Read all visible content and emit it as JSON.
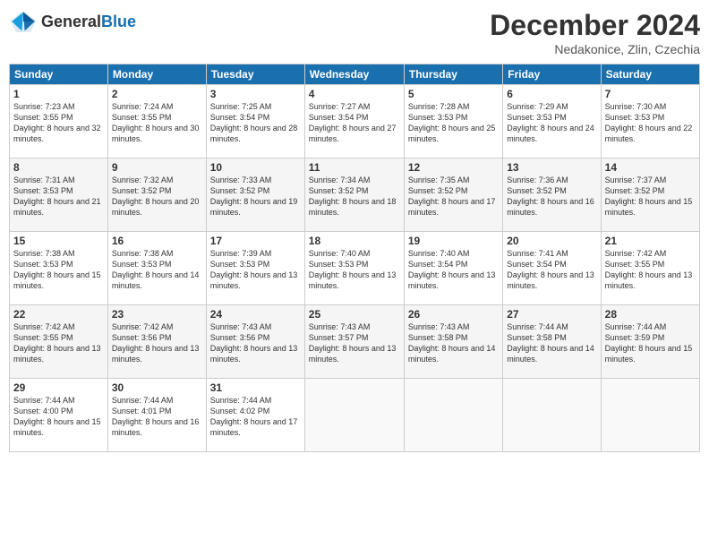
{
  "header": {
    "logo_general": "General",
    "logo_blue": "Blue",
    "month": "December 2024",
    "location": "Nedakonice, Zlin, Czechia"
  },
  "days_of_week": [
    "Sunday",
    "Monday",
    "Tuesday",
    "Wednesday",
    "Thursday",
    "Friday",
    "Saturday"
  ],
  "weeks": [
    [
      {
        "day": "1",
        "sunrise": "7:23 AM",
        "sunset": "3:55 PM",
        "daylight": "8 hours and 32 minutes."
      },
      {
        "day": "2",
        "sunrise": "7:24 AM",
        "sunset": "3:55 PM",
        "daylight": "8 hours and 30 minutes."
      },
      {
        "day": "3",
        "sunrise": "7:25 AM",
        "sunset": "3:54 PM",
        "daylight": "8 hours and 28 minutes."
      },
      {
        "day": "4",
        "sunrise": "7:27 AM",
        "sunset": "3:54 PM",
        "daylight": "8 hours and 27 minutes."
      },
      {
        "day": "5",
        "sunrise": "7:28 AM",
        "sunset": "3:53 PM",
        "daylight": "8 hours and 25 minutes."
      },
      {
        "day": "6",
        "sunrise": "7:29 AM",
        "sunset": "3:53 PM",
        "daylight": "8 hours and 24 minutes."
      },
      {
        "day": "7",
        "sunrise": "7:30 AM",
        "sunset": "3:53 PM",
        "daylight": "8 hours and 22 minutes."
      }
    ],
    [
      {
        "day": "8",
        "sunrise": "7:31 AM",
        "sunset": "3:53 PM",
        "daylight": "8 hours and 21 minutes."
      },
      {
        "day": "9",
        "sunrise": "7:32 AM",
        "sunset": "3:52 PM",
        "daylight": "8 hours and 20 minutes."
      },
      {
        "day": "10",
        "sunrise": "7:33 AM",
        "sunset": "3:52 PM",
        "daylight": "8 hours and 19 minutes."
      },
      {
        "day": "11",
        "sunrise": "7:34 AM",
        "sunset": "3:52 PM",
        "daylight": "8 hours and 18 minutes."
      },
      {
        "day": "12",
        "sunrise": "7:35 AM",
        "sunset": "3:52 PM",
        "daylight": "8 hours and 17 minutes."
      },
      {
        "day": "13",
        "sunrise": "7:36 AM",
        "sunset": "3:52 PM",
        "daylight": "8 hours and 16 minutes."
      },
      {
        "day": "14",
        "sunrise": "7:37 AM",
        "sunset": "3:52 PM",
        "daylight": "8 hours and 15 minutes."
      }
    ],
    [
      {
        "day": "15",
        "sunrise": "7:38 AM",
        "sunset": "3:53 PM",
        "daylight": "8 hours and 15 minutes."
      },
      {
        "day": "16",
        "sunrise": "7:38 AM",
        "sunset": "3:53 PM",
        "daylight": "8 hours and 14 minutes."
      },
      {
        "day": "17",
        "sunrise": "7:39 AM",
        "sunset": "3:53 PM",
        "daylight": "8 hours and 13 minutes."
      },
      {
        "day": "18",
        "sunrise": "7:40 AM",
        "sunset": "3:53 PM",
        "daylight": "8 hours and 13 minutes."
      },
      {
        "day": "19",
        "sunrise": "7:40 AM",
        "sunset": "3:54 PM",
        "daylight": "8 hours and 13 minutes."
      },
      {
        "day": "20",
        "sunrise": "7:41 AM",
        "sunset": "3:54 PM",
        "daylight": "8 hours and 13 minutes."
      },
      {
        "day": "21",
        "sunrise": "7:42 AM",
        "sunset": "3:55 PM",
        "daylight": "8 hours and 13 minutes."
      }
    ],
    [
      {
        "day": "22",
        "sunrise": "7:42 AM",
        "sunset": "3:55 PM",
        "daylight": "8 hours and 13 minutes."
      },
      {
        "day": "23",
        "sunrise": "7:42 AM",
        "sunset": "3:56 PM",
        "daylight": "8 hours and 13 minutes."
      },
      {
        "day": "24",
        "sunrise": "7:43 AM",
        "sunset": "3:56 PM",
        "daylight": "8 hours and 13 minutes."
      },
      {
        "day": "25",
        "sunrise": "7:43 AM",
        "sunset": "3:57 PM",
        "daylight": "8 hours and 13 minutes."
      },
      {
        "day": "26",
        "sunrise": "7:43 AM",
        "sunset": "3:58 PM",
        "daylight": "8 hours and 14 minutes."
      },
      {
        "day": "27",
        "sunrise": "7:44 AM",
        "sunset": "3:58 PM",
        "daylight": "8 hours and 14 minutes."
      },
      {
        "day": "28",
        "sunrise": "7:44 AM",
        "sunset": "3:59 PM",
        "daylight": "8 hours and 15 minutes."
      }
    ],
    [
      {
        "day": "29",
        "sunrise": "7:44 AM",
        "sunset": "4:00 PM",
        "daylight": "8 hours and 15 minutes."
      },
      {
        "day": "30",
        "sunrise": "7:44 AM",
        "sunset": "4:01 PM",
        "daylight": "8 hours and 16 minutes."
      },
      {
        "day": "31",
        "sunrise": "7:44 AM",
        "sunset": "4:02 PM",
        "daylight": "8 hours and 17 minutes."
      },
      null,
      null,
      null,
      null
    ]
  ]
}
